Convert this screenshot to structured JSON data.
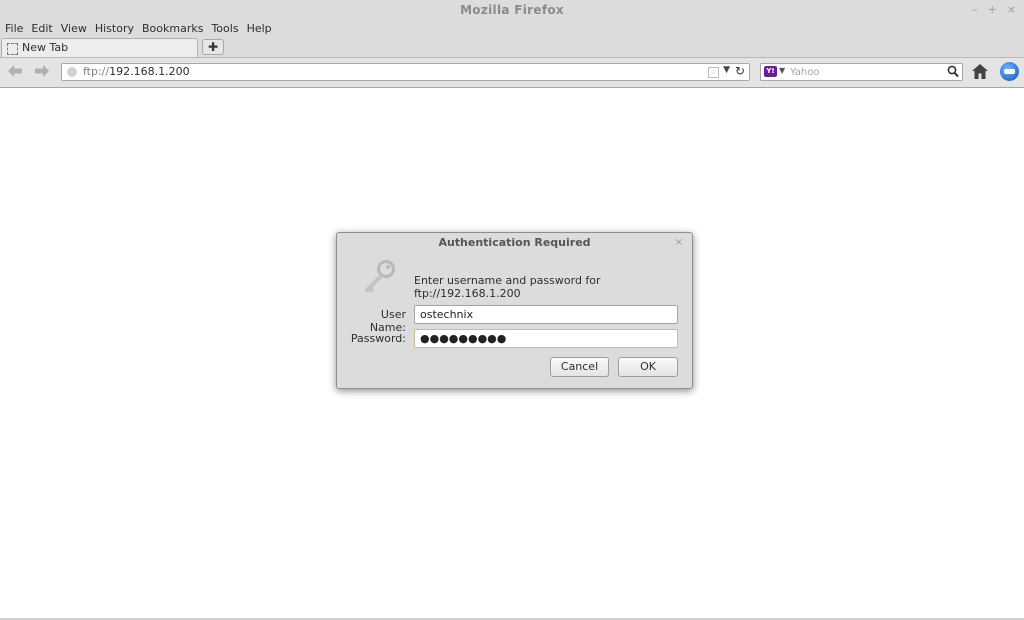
{
  "window": {
    "title": "Mozilla Firefox",
    "controls": {
      "minimize": "–",
      "maximize": "+",
      "close": "×"
    }
  },
  "menu": [
    "File",
    "Edit",
    "View",
    "History",
    "Bookmarks",
    "Tools",
    "Help"
  ],
  "tabs": [
    {
      "label": "New Tab",
      "active": true
    }
  ],
  "new_tab_label": "✚",
  "navbar": {
    "url_scheme": "ftp://",
    "url_rest": "192.168.1.200",
    "search_engine_badge": "Y!",
    "search_placeholder": "Yahoo"
  },
  "dialog": {
    "title": "Authentication Required",
    "close": "×",
    "message": "Enter username and password for ftp://192.168.1.200",
    "username_label": "User Name:",
    "username_value": "ostechnix",
    "password_label": "Password:",
    "password_value": "●●●●●●●●●",
    "cancel_label": "Cancel",
    "ok_label": "OK"
  },
  "colors": {
    "chrome": "#dcdcdc",
    "search_engine": "#6a1f95",
    "addon_button": "#0a56b8"
  }
}
